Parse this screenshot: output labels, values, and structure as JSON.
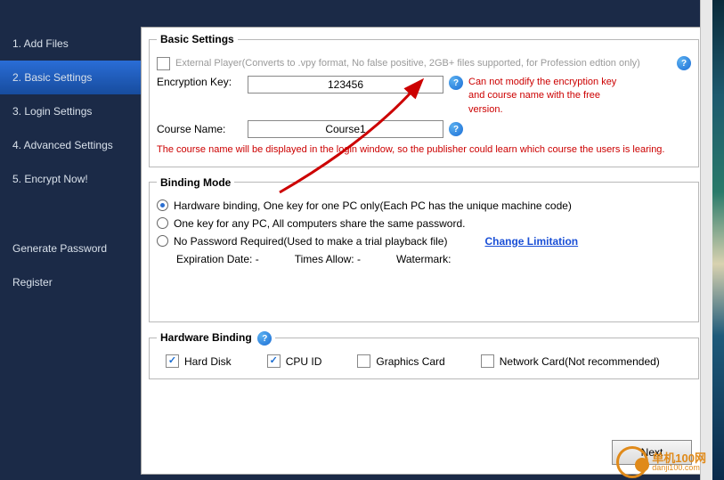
{
  "sidebar": {
    "items": [
      {
        "label": "1. Add Files"
      },
      {
        "label": "2. Basic Settings"
      },
      {
        "label": "3. Login Settings"
      },
      {
        "label": "4. Advanced Settings"
      },
      {
        "label": "5. Encrypt Now!"
      }
    ],
    "extras": [
      {
        "label": "Generate Password"
      },
      {
        "label": "Register"
      }
    ]
  },
  "basic": {
    "title": "Basic Settings",
    "external_label": "External Player(Converts to .vpy format, No false positive, 2GB+ files supported, for Profession edtion only)",
    "key_label": "Encryption Key:",
    "key_value": "123456",
    "key_warn": "Can not modify the encryption key and course name with the free version.",
    "course_label": "Course Name:",
    "course_value": "Course1",
    "course_note": "The course name will be displayed in the login window, so the publisher could learn which course the users is learing."
  },
  "binding": {
    "title": "Binding Mode",
    "opt1": "Hardware binding, One key for one PC only(Each PC has the unique machine code)",
    "opt2": "One key for any PC, All computers share the same password.",
    "opt3": "No Password Required(Used to make a trial playback file)",
    "change": "Change Limitation",
    "exp": "Expiration Date:  -",
    "times": "Times Allow:  -",
    "wm": "Watermark:"
  },
  "hw": {
    "title": "Hardware Binding",
    "hd": "Hard Disk",
    "cpu": "CPU ID",
    "gpu": "Graphics Card",
    "net": "Network Card(Not recommended)"
  },
  "footer": {
    "next": "Next"
  },
  "watermark": {
    "t1": "单机100网",
    "t2": "danji100.com"
  }
}
